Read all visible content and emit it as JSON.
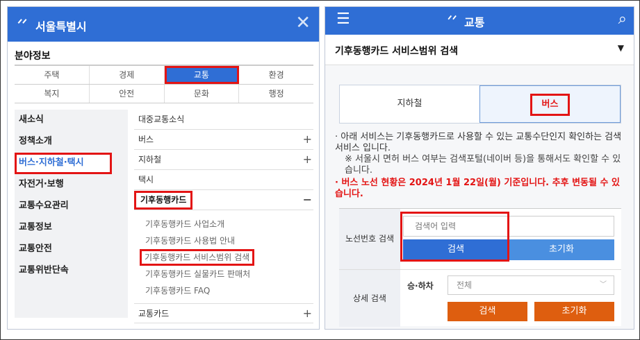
{
  "left": {
    "header": {
      "logo_icon": "seoul-logo-icon",
      "title": "서울특별시",
      "close_icon": "close-icon"
    },
    "section": "분야정보",
    "categories": [
      [
        "주택",
        "경제",
        "교통",
        "환경"
      ],
      [
        "복지",
        "안전",
        "문화",
        "행정"
      ]
    ],
    "active_category": "교통",
    "menu1": [
      "새소식",
      "정책소개",
      "버스·지하철·택시",
      "자전거·보행",
      "교통수요관리",
      "교통정보",
      "교통안전",
      "교통위반단속"
    ],
    "menu2": [
      {
        "label": "대중교통소식",
        "sign": ""
      },
      {
        "label": "버스",
        "sign": "+"
      },
      {
        "label": "지하철",
        "sign": "+"
      },
      {
        "label": "택시",
        "sign": ""
      },
      {
        "label": "기후동행카드",
        "sign": "−"
      }
    ],
    "submenu": [
      "기후동행카드 사업소개",
      "기후동행카드 사용법 안내",
      "기후동행카드 서비스범위 검색",
      "기후동행카드 실물카드 판매처",
      "기후동행카드 FAQ"
    ],
    "last_item": {
      "label": "교통카드",
      "sign": "+"
    }
  },
  "right": {
    "header": {
      "menu_icon": "hamburger-icon",
      "logo_icon": "seoul-logo-icon",
      "title": "교통",
      "search_icon": "search-icon"
    },
    "subtitle": "기후동행카드 서비스범위 검색",
    "caret": "▼",
    "tabs": [
      "지하철",
      "버스"
    ],
    "notes": [
      "· 아래 서비스는 기후동행카드로 사용할 수 있는 교통수단인지 확인하는 검색 서비스 입니다.",
      "※ 서울시 면허 버스 여부는 검색포털(네이버 등)을 통해서도 확인할 수 있습니다.",
      "· 버스 노선 현황은 2024년 1월 22일(월) 기준입니다. 추후 변동될 수 있습니다."
    ],
    "form": {
      "route_label": "노선번호 검색",
      "input_placeholder": "검색어 입력",
      "search_button": "검색",
      "reset_button": "초기화",
      "detail_label": "상세 검색",
      "ride_label": "승·하차",
      "select_value": "전체",
      "search_button2": "검색",
      "reset_button2": "초기화"
    }
  },
  "colors": {
    "primary": "#2f6ed5",
    "highlight": "#e31414",
    "orange": "#de5e0f"
  }
}
